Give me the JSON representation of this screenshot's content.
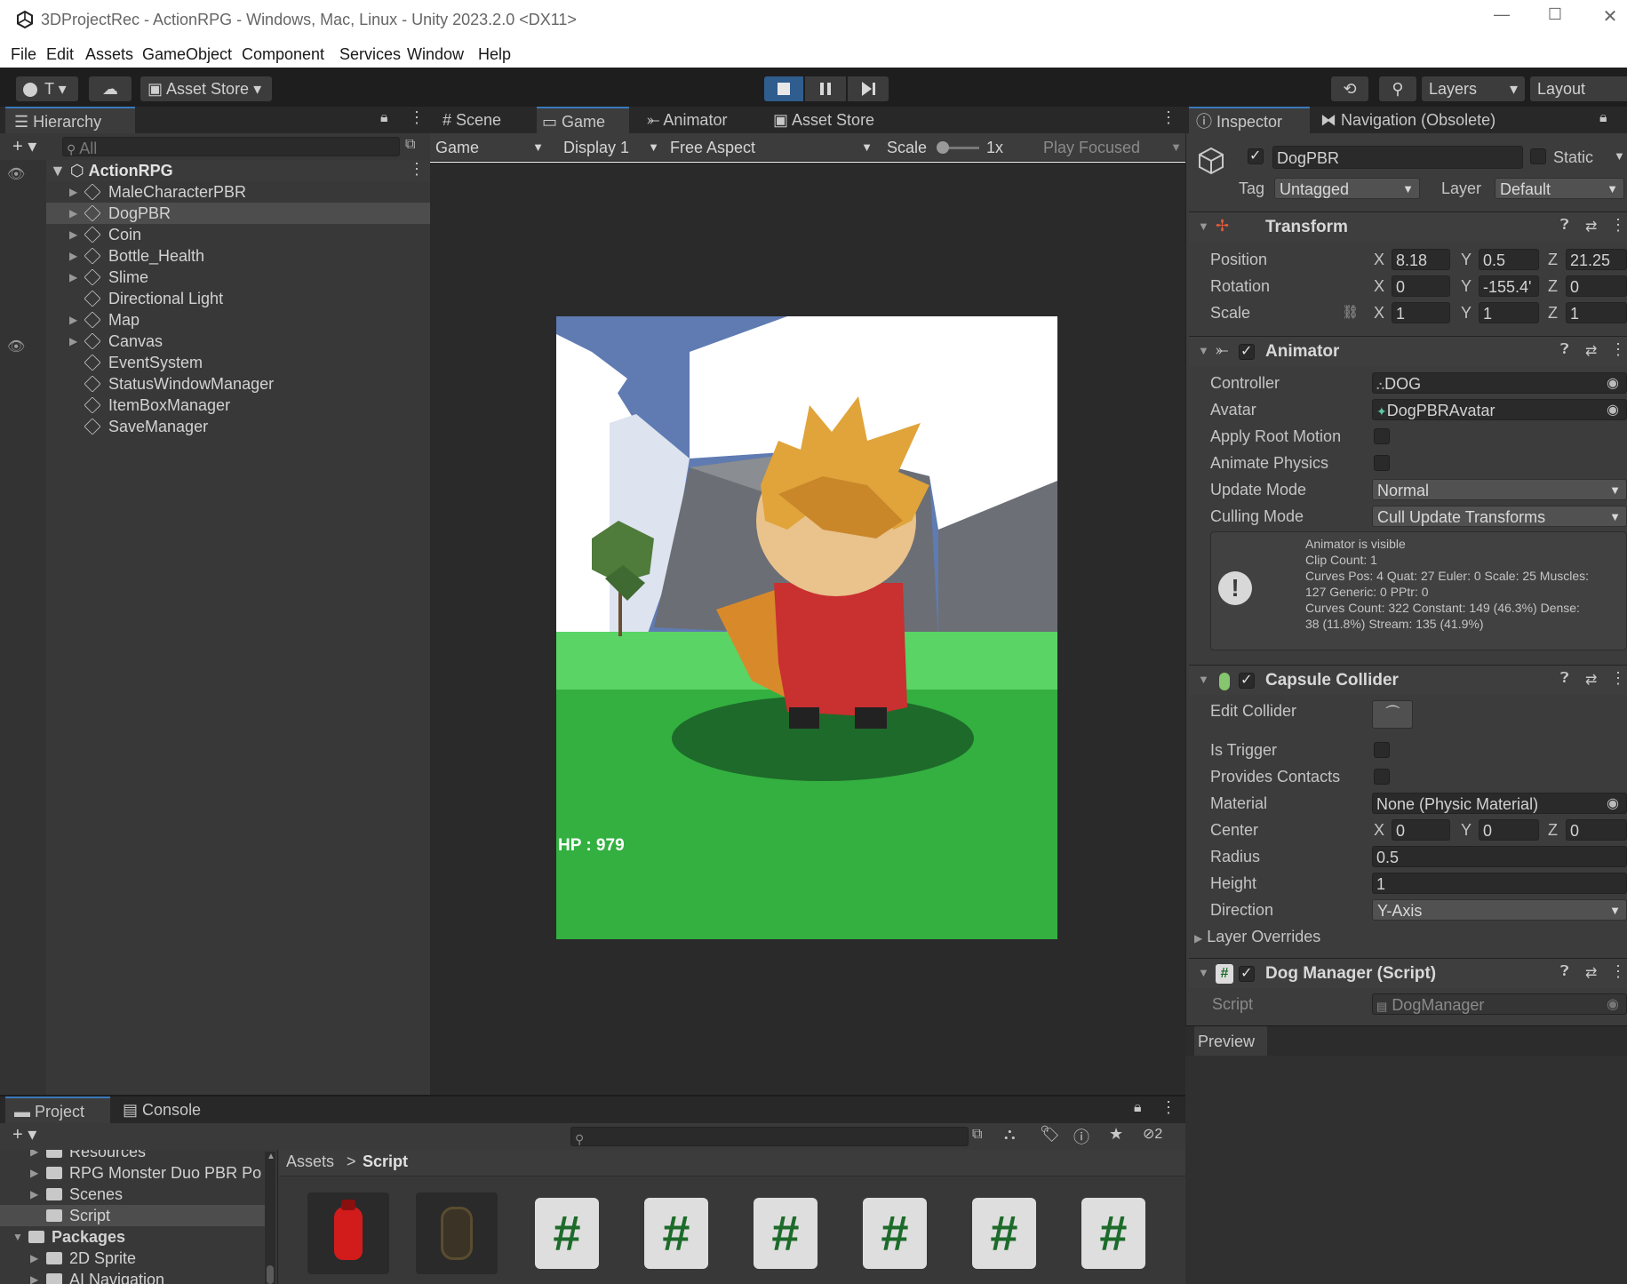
{
  "window": {
    "title": "3DProjectRec - ActionRPG - Windows, Mac, Linux - Unity 2023.2.0 <DX11>",
    "controls": [
      "—",
      "☐",
      "✕"
    ]
  },
  "menu": [
    "File",
    "Edit",
    "Assets",
    "GameObject",
    "Component",
    "Services",
    "Window",
    "Help"
  ],
  "toolbar": {
    "account": "T",
    "asset_store": "Asset Store",
    "layers": "Layers",
    "layout": "Layout"
  },
  "hierarchy": {
    "tab": "Hierarchy",
    "search_placeholder": "All",
    "scene": "ActionRPG",
    "items": [
      {
        "label": "MaleCharacterPBR",
        "expandable": true
      },
      {
        "label": "DogPBR",
        "expandable": true,
        "selected": true
      },
      {
        "label": "Coin",
        "expandable": true
      },
      {
        "label": "Bottle_Health",
        "expandable": true
      },
      {
        "label": "Slime",
        "expandable": true
      },
      {
        "label": "Directional Light",
        "expandable": false
      },
      {
        "label": "Map",
        "expandable": true
      },
      {
        "label": "Canvas",
        "expandable": true
      },
      {
        "label": "EventSystem",
        "expandable": false
      },
      {
        "label": "StatusWindowManager",
        "expandable": false
      },
      {
        "label": "ItemBoxManager",
        "expandable": false
      },
      {
        "label": "SaveManager",
        "expandable": false
      }
    ]
  },
  "center": {
    "tabs": [
      {
        "label": "Scene",
        "icon": "grid-icon"
      },
      {
        "label": "Game",
        "icon": "gamepad-icon",
        "active": true
      },
      {
        "label": "Animator",
        "icon": "animator-icon"
      },
      {
        "label": "Asset Store",
        "icon": "bag-icon"
      }
    ],
    "game_toolbar": {
      "mode": "Game",
      "display": "Display 1",
      "aspect": "Free Aspect",
      "scale_label": "Scale",
      "scale_value": "1x",
      "play_focused": "Play Focused"
    },
    "hud": "HP : 979"
  },
  "inspector": {
    "tabs": [
      {
        "label": "Inspector",
        "active": true
      },
      {
        "label": "Navigation (Obsolete)"
      }
    ],
    "object_name": "DogPBR",
    "static_label": "Static",
    "tag_label": "Tag",
    "tag_value": "Untagged",
    "layer_label": "Layer",
    "layer_value": "Default",
    "transform": {
      "title": "Transform",
      "position": {
        "label": "Position",
        "x": "8.18",
        "y": "0.5",
        "z": "21.25"
      },
      "rotation": {
        "label": "Rotation",
        "x": "0",
        "y": "-155.4'",
        "z": "0"
      },
      "scale": {
        "label": "Scale",
        "x": "1",
        "y": "1",
        "z": "1"
      }
    },
    "animator": {
      "title": "Animator",
      "controller_label": "Controller",
      "controller_value": "DOG",
      "avatar_label": "Avatar",
      "avatar_value": "DogPBRAvatar",
      "apply_root_motion": "Apply Root Motion",
      "animate_physics": "Animate Physics",
      "update_mode_label": "Update Mode",
      "update_mode_value": "Normal",
      "culling_mode_label": "Culling Mode",
      "culling_mode_value": "Cull Update Transforms",
      "info_lines": [
        "Animator is visible",
        "Clip Count: 1",
        "Curves Pos: 4 Quat: 27 Euler: 0 Scale: 25 Muscles:",
        "127 Generic: 0 PPtr: 0",
        "Curves Count: 322 Constant: 149 (46.3%) Dense:",
        "38 (11.8%) Stream: 135 (41.9%)"
      ]
    },
    "capsule": {
      "title": "Capsule Collider",
      "edit_collider": "Edit Collider",
      "is_trigger": "Is Trigger",
      "provides_contacts": "Provides Contacts",
      "material_label": "Material",
      "material_value": "None (Physic Material)",
      "center_label": "Center",
      "center": {
        "x": "0",
        "y": "0",
        "z": "0"
      },
      "radius_label": "Radius",
      "radius_value": "0.5",
      "height_label": "Height",
      "height_value": "1",
      "direction_label": "Direction",
      "direction_value": "Y-Axis",
      "layer_overrides": "Layer Overrides"
    },
    "dog_manager": {
      "title": "Dog Manager (Script)",
      "script_label": "Script",
      "script_value": "DogManager"
    },
    "preview": "Preview"
  },
  "project": {
    "tabs": [
      {
        "label": "Project",
        "active": true
      },
      {
        "label": "Console"
      }
    ],
    "badge": "2",
    "tree": [
      {
        "label": "Resources",
        "indent": 1
      },
      {
        "label": "RPG Monster Duo PBR Po",
        "indent": 1
      },
      {
        "label": "Scenes",
        "indent": 1
      },
      {
        "label": "Script",
        "indent": 1,
        "selected": true
      },
      {
        "label": "Packages",
        "indent": 0,
        "bold": true
      },
      {
        "label": "2D Sprite",
        "indent": 1
      },
      {
        "label": "AI Navigation",
        "indent": 1
      }
    ],
    "breadcrumb": [
      "Assets",
      "Script"
    ],
    "asset_icons": [
      "potion",
      "chest",
      "#",
      "#",
      "#",
      "#",
      "#",
      "#"
    ]
  },
  "colors": {
    "accent": "#3a79bb",
    "panel": "#383838",
    "tabbar": "#282828",
    "selection": "#4d4d4d",
    "script_green": "#1d6b2a"
  }
}
